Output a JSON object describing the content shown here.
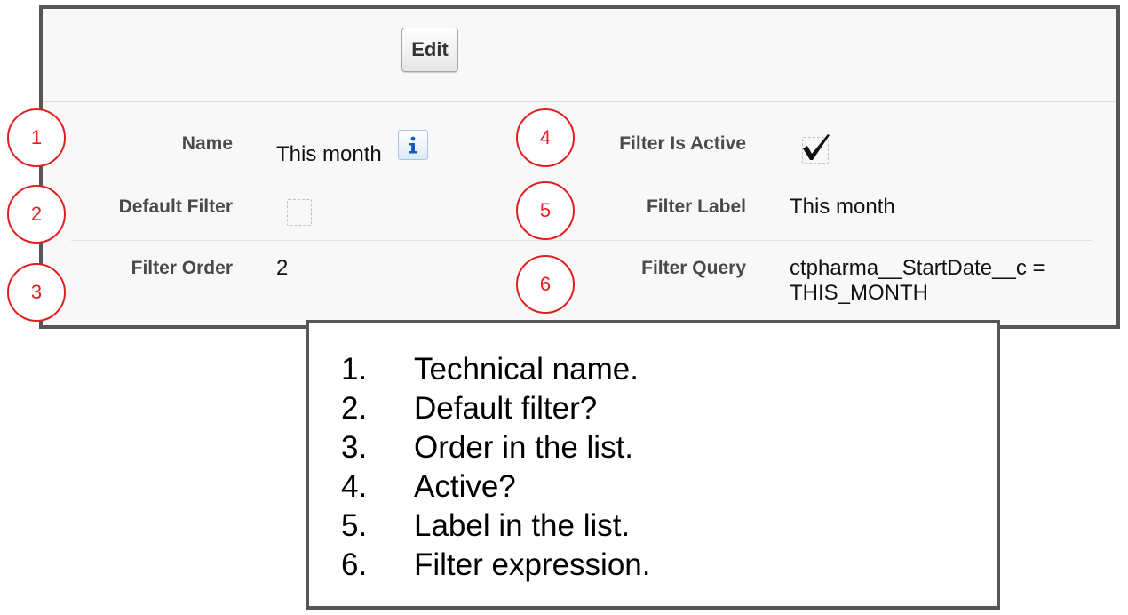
{
  "toolbar": {
    "edit_label": "Edit"
  },
  "fields": {
    "name": {
      "label": "Name",
      "value": "This month"
    },
    "default_filter": {
      "label": "Default Filter",
      "checked": false
    },
    "filter_order": {
      "label": "Filter Order",
      "value": "2"
    },
    "filter_is_active": {
      "label": "Filter Is Active",
      "checked": true
    },
    "filter_label": {
      "label": "Filter Label",
      "value": "This month"
    },
    "filter_query": {
      "label": "Filter Query",
      "value_line1": "ctpharma__StartDate__c =",
      "value_line2": "THIS_MONTH"
    }
  },
  "callouts": [
    "1",
    "2",
    "3",
    "4",
    "5",
    "6"
  ],
  "legend": [
    {
      "num": "1.",
      "text": "Technical name."
    },
    {
      "num": "2.",
      "text": "Default filter?"
    },
    {
      "num": "3.",
      "text": "Order in the list."
    },
    {
      "num": "4.",
      "text": "Active?"
    },
    {
      "num": "5.",
      "text": "Label in the list."
    },
    {
      "num": "6.",
      "text": "Filter expression."
    }
  ],
  "icons": {
    "info": "info-icon",
    "check": "checkmark-icon"
  },
  "colors": {
    "callout_red": "#e02020",
    "border_dark": "#565656",
    "info_blue": "#1a5bb8"
  }
}
